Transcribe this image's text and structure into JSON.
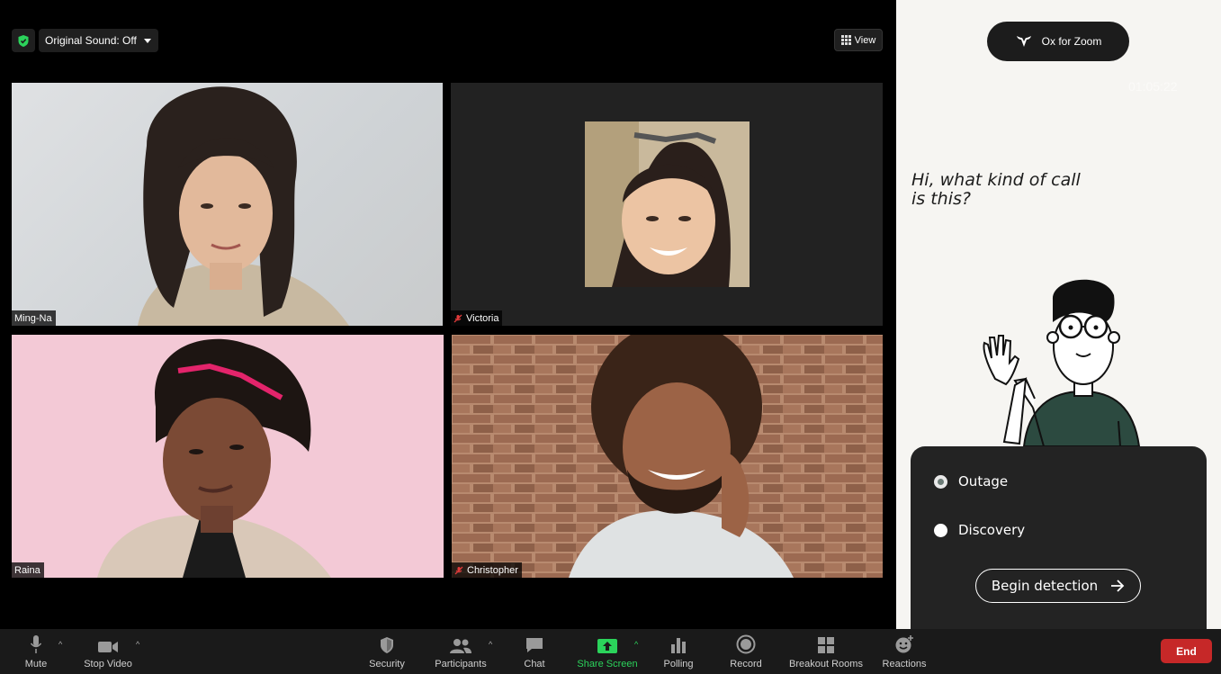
{
  "header": {
    "sound_label": "Original Sound: Off",
    "view_label": "View"
  },
  "participants": [
    {
      "name": "Ming-Na",
      "muted": false
    },
    {
      "name": "Victoria",
      "muted": true
    },
    {
      "name": "Raina",
      "muted": false
    },
    {
      "name": "Christopher",
      "muted": true
    }
  ],
  "toolbar": {
    "mute": "Mute",
    "stop_video": "Stop Video",
    "security": "Security",
    "participants": "Participants",
    "chat": "Chat",
    "share_screen": "Share Screen",
    "polling": "Polling",
    "record": "Record",
    "breakout_rooms": "Breakout Rooms",
    "reactions": "Reactions",
    "end": "End"
  },
  "panel": {
    "app_name": "Ox for Zoom",
    "timer": "01:05:22",
    "question": "Hi, what kind of call is this?",
    "options": [
      {
        "label": "Outage",
        "selected": true
      },
      {
        "label": "Discovery",
        "selected": false
      }
    ],
    "action_label": "Begin detection"
  },
  "colors": {
    "accent_green": "#2bd35b",
    "end_red": "#c62828",
    "panel_bg": "#f6f5f2",
    "card_bg": "#232323"
  }
}
